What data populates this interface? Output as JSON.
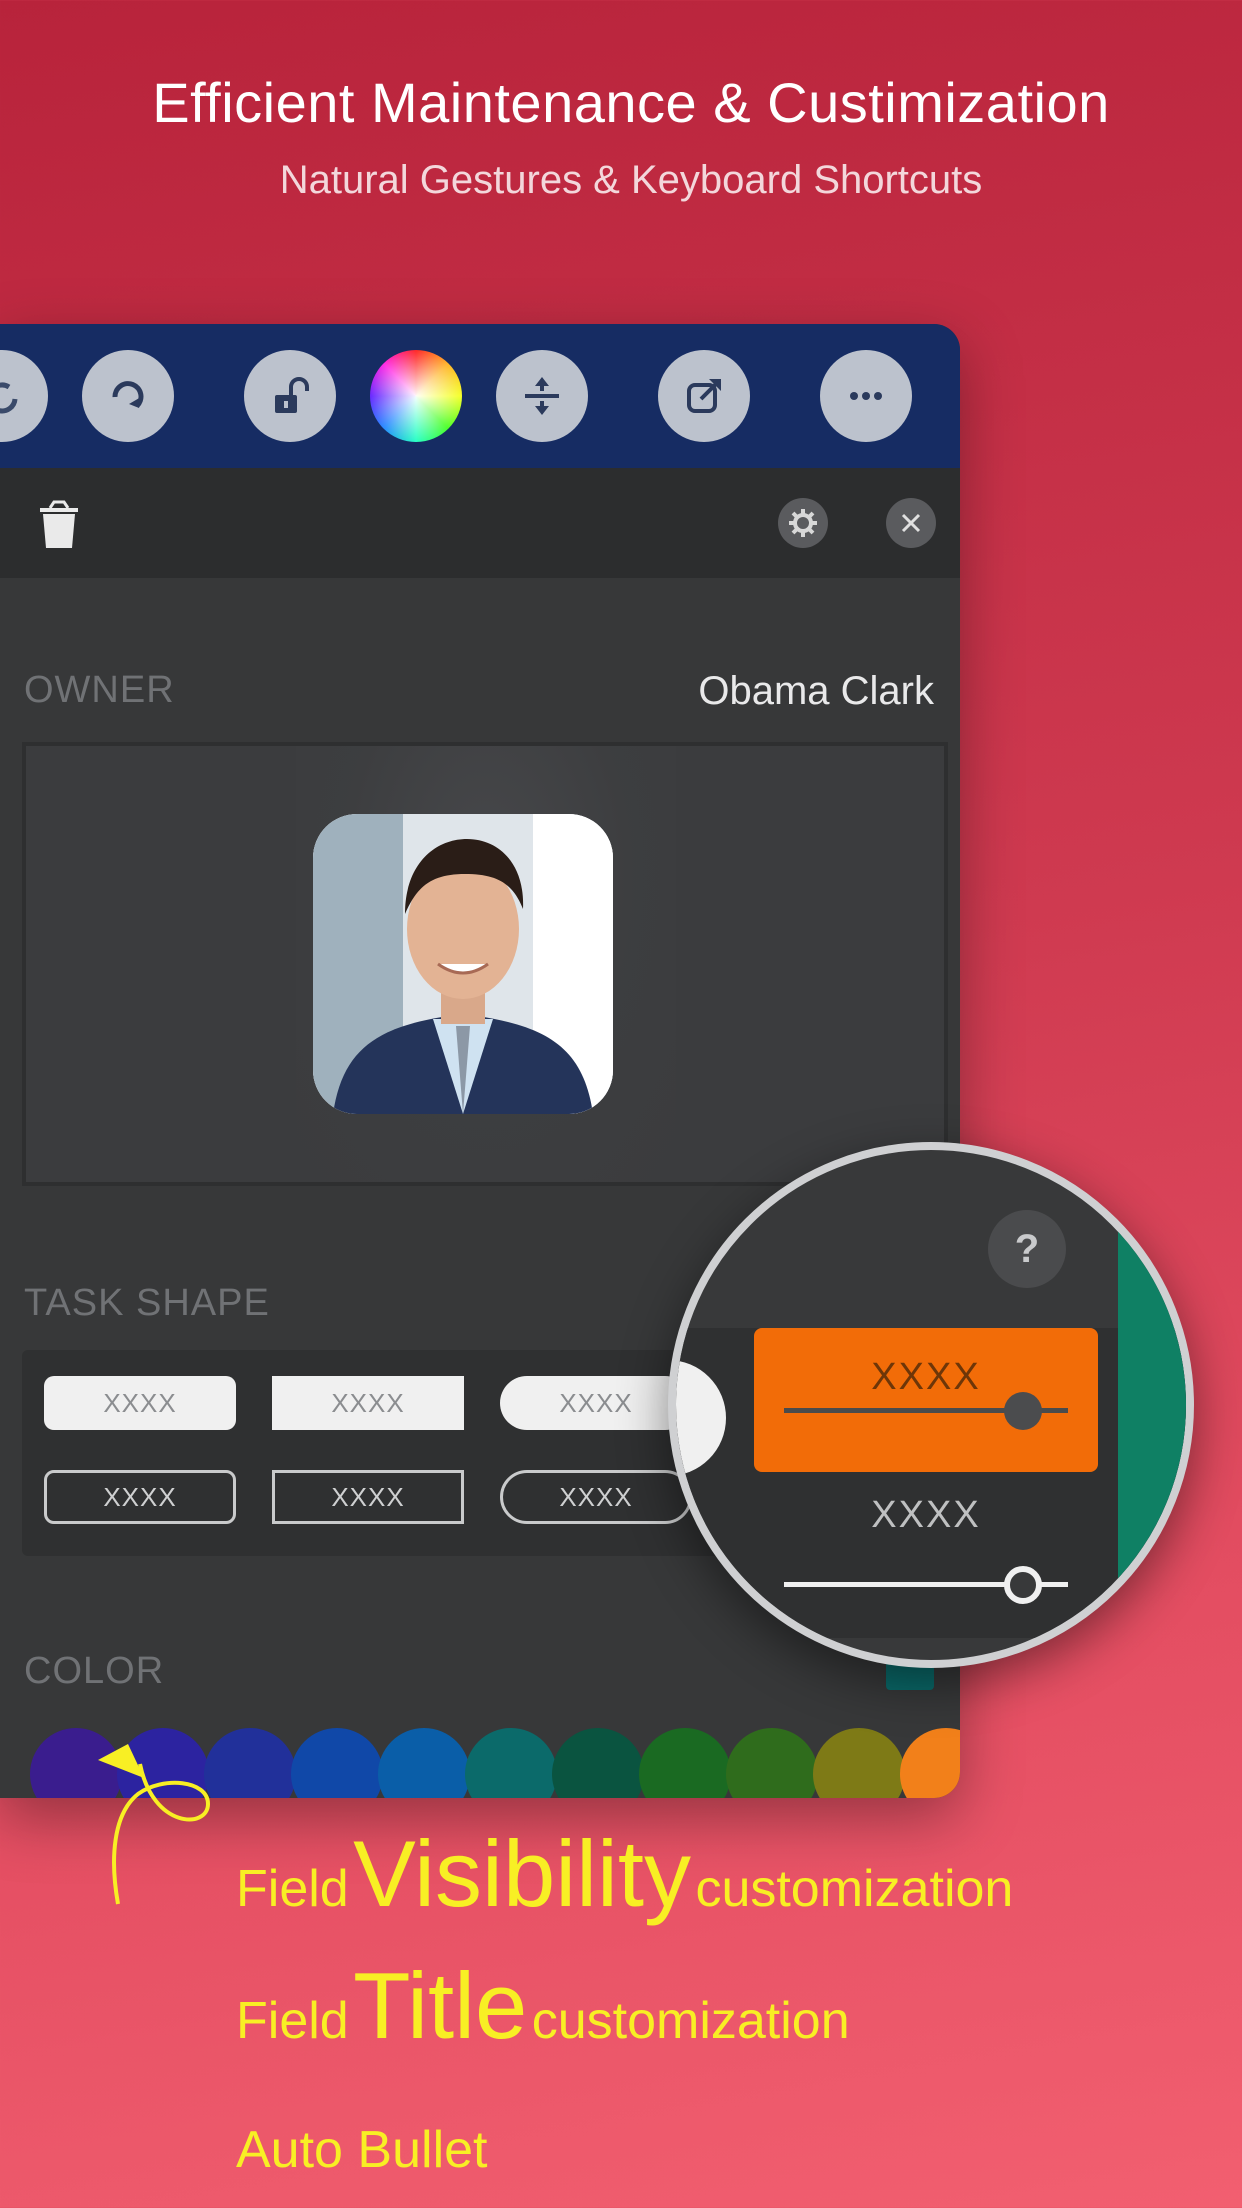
{
  "headline": "Efficient Maintenance & Custimization",
  "subheadline": "Natural Gestures & Keyboard Shortcuts",
  "toolbar": {
    "buttons": [
      "undo-icon",
      "redo-icon",
      "unlock-icon",
      "color-wheel-icon",
      "expand-vertical-icon",
      "share-icon",
      "more-icon"
    ]
  },
  "panel": {
    "owner_label": "OWNER",
    "owner_value": "Obama Clark",
    "task_shape_label": "TASK SHAPE",
    "color_label": "COLOR",
    "shape_chips": [
      "XXXX",
      "XXXX",
      "XXXX",
      "XXXX",
      "XXXX",
      "XXXX"
    ],
    "swatch_colors": [
      "#3a1d8e",
      "#2c23a0",
      "#21309a",
      "#1048a8",
      "#0a5ea8",
      "#0b6a6a",
      "#0a5440",
      "#1a6a22",
      "#2f6c1c",
      "#7e7a16",
      "#f2801a"
    ]
  },
  "magnifier": {
    "help": "?",
    "slider_1_label": "XXXX",
    "slider_2_label": "XXXX",
    "slider_1_value": 0.84,
    "slider_2_value": 0.84,
    "accent": "#f26c08"
  },
  "promo": {
    "line1_pre": "Field",
    "line1_big": "Visibility",
    "line1_post": "customization",
    "line2_pre": "Field",
    "line2_big": "Title",
    "line2_post": "customization",
    "line3": "Auto Bullet"
  }
}
